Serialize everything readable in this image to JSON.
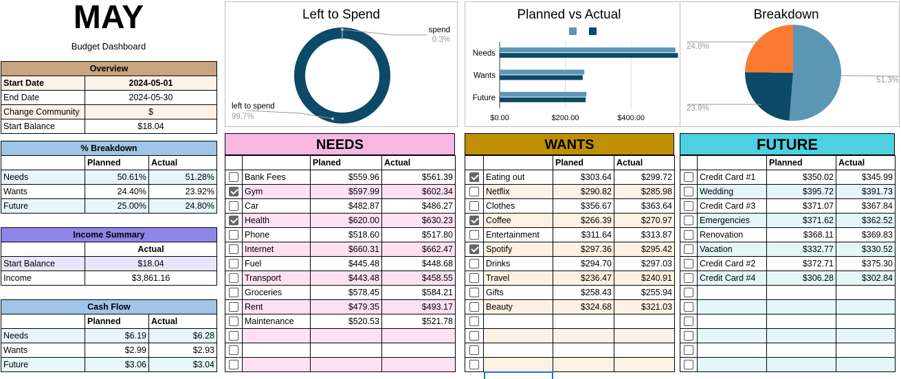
{
  "header": {
    "month": "MAY",
    "subtitle": "Budget Dashboard"
  },
  "overview": {
    "title": "Overview",
    "rows": [
      {
        "label": "Start Date",
        "value": "2024-05-01"
      },
      {
        "label": "End Date",
        "value": "2024-05-30"
      },
      {
        "label": "Change Community",
        "value": "$"
      },
      {
        "label": "Start Balance",
        "value": "$18.04"
      }
    ]
  },
  "breakdown_table": {
    "title": "% Breakdown",
    "col_planned": "Planned",
    "col_actual": "Actual",
    "rows": [
      {
        "label": "Needs",
        "planned": "50.61%",
        "actual": "51.28%"
      },
      {
        "label": "Wants",
        "planned": "24.40%",
        "actual": "23.92%"
      },
      {
        "label": "Future",
        "planned": "25.00%",
        "actual": "24.80%"
      }
    ]
  },
  "income": {
    "title": "Income Summary",
    "col_actual": "Actual",
    "rows": [
      {
        "label": "Start Balance",
        "value": "$18.04"
      },
      {
        "label": "Income",
        "value": "$3,861.16"
      }
    ]
  },
  "cashflow": {
    "title": "Cash Flow",
    "col_planned": "Planned",
    "col_actual": "Actual",
    "rows": [
      {
        "label": "Needs",
        "planned": "$6.19",
        "actual": "$6.28"
      },
      {
        "label": "Wants",
        "planned": "$2.99",
        "actual": "$2.93"
      },
      {
        "label": "Future",
        "planned": "$3.06",
        "actual": "$3.04"
      }
    ]
  },
  "needs": {
    "title": "NEEDS",
    "col_planned": "Planed",
    "col_actual": "Actual",
    "items": [
      {
        "checked": false,
        "name": "Bank Fees",
        "planned": "$559.96",
        "actual": "$561.39"
      },
      {
        "checked": true,
        "name": "Gym",
        "planned": "$597.99",
        "actual": "$602.34"
      },
      {
        "checked": false,
        "name": "Car",
        "planned": "$482.87",
        "actual": "$486.27"
      },
      {
        "checked": true,
        "name": "Health",
        "planned": "$620.00",
        "actual": "$630.23"
      },
      {
        "checked": false,
        "name": "Phone",
        "planned": "$518.60",
        "actual": "$517.80"
      },
      {
        "checked": false,
        "name": "Internet",
        "planned": "$660.31",
        "actual": "$662.47"
      },
      {
        "checked": false,
        "name": "Fuel",
        "planned": "$445.48",
        "actual": "$448.68"
      },
      {
        "checked": false,
        "name": "Transport",
        "planned": "$443.48",
        "actual": "$458.55"
      },
      {
        "checked": false,
        "name": "Groceries",
        "planned": "$578.45",
        "actual": "$584.21"
      },
      {
        "checked": false,
        "name": "Rent",
        "planned": "$479.35",
        "actual": "$493.17"
      },
      {
        "checked": false,
        "name": "Maintenance",
        "planned": "$520.53",
        "actual": "$521.78"
      },
      {
        "checked": false,
        "name": "",
        "planned": "",
        "actual": ""
      },
      {
        "checked": false,
        "name": "",
        "planned": "",
        "actual": ""
      },
      {
        "checked": false,
        "name": "",
        "planned": "",
        "actual": ""
      }
    ]
  },
  "wants": {
    "title": "WANTS",
    "col_planned": "Planed",
    "col_actual": "Actual",
    "items": [
      {
        "checked": true,
        "name": "Eating out",
        "planned": "$303.64",
        "actual": "$299.72"
      },
      {
        "checked": false,
        "name": "Netflix",
        "planned": "$290.82",
        "actual": "$285.98"
      },
      {
        "checked": false,
        "name": "Clothes",
        "planned": "$356.67",
        "actual": "$363.64"
      },
      {
        "checked": true,
        "name": "Coffee",
        "planned": "$266.39",
        "actual": "$270.97"
      },
      {
        "checked": false,
        "name": "Entertainment",
        "planned": "$311.64",
        "actual": "$313.87"
      },
      {
        "checked": true,
        "name": "Spotify",
        "planned": "$297.36",
        "actual": "$295.42"
      },
      {
        "checked": false,
        "name": "Drinks",
        "planned": "$294.70",
        "actual": "$297.03"
      },
      {
        "checked": false,
        "name": "Travel",
        "planned": "$236.47",
        "actual": "$240.91"
      },
      {
        "checked": false,
        "name": "Gifts",
        "planned": "$258.43",
        "actual": "$255.94"
      },
      {
        "checked": false,
        "name": "Beauty",
        "planned": "$324.68",
        "actual": "$321.03"
      },
      {
        "checked": false,
        "name": "",
        "planned": "",
        "actual": ""
      },
      {
        "checked": false,
        "name": "",
        "planned": "",
        "actual": ""
      },
      {
        "checked": false,
        "name": "",
        "planned": "",
        "actual": ""
      },
      {
        "checked": false,
        "name": "",
        "planned": "",
        "actual": ""
      }
    ]
  },
  "future": {
    "title": "FUTURE",
    "col_planned": "Planned",
    "col_actual": "Actual",
    "items": [
      {
        "checked": false,
        "name": "Credit Card #1",
        "planned": "$350.02",
        "actual": "$345.99"
      },
      {
        "checked": false,
        "name": "Wedding",
        "planned": "$395.72",
        "actual": "$391.73"
      },
      {
        "checked": false,
        "name": "Credit Card #3",
        "planned": "$371.07",
        "actual": "$367.84"
      },
      {
        "checked": false,
        "name": "Emergencies",
        "planned": "$371.62",
        "actual": "$362.52"
      },
      {
        "checked": false,
        "name": "Renovation",
        "planned": "$368.11",
        "actual": "$369.83"
      },
      {
        "checked": false,
        "name": "Vacation",
        "planned": "$332.77",
        "actual": "$330.52"
      },
      {
        "checked": false,
        "name": "Credit Card #2",
        "planned": "$372.71",
        "actual": "$375.30"
      },
      {
        "checked": false,
        "name": "Credit Card #4",
        "planned": "$306.28",
        "actual": "$302.84"
      },
      {
        "checked": false,
        "name": "",
        "planned": "",
        "actual": ""
      },
      {
        "checked": false,
        "name": "",
        "planned": "",
        "actual": ""
      },
      {
        "checked": false,
        "name": "",
        "planned": "",
        "actual": ""
      },
      {
        "checked": false,
        "name": "",
        "planned": "",
        "actual": ""
      },
      {
        "checked": false,
        "name": "",
        "planned": "",
        "actual": ""
      },
      {
        "checked": false,
        "name": "",
        "planned": "",
        "actual": ""
      }
    ]
  },
  "colors": {
    "overview": "#c9a57f",
    "overview_row": "#fdf3e8",
    "breakdown": "#9fc5e8",
    "breakdown_row": "#e6f7f7",
    "income": "#8e85e6",
    "income_row": "#e8e6fb",
    "needs": "#f6b8e2",
    "needs_row": "#fde1f2",
    "wants": "#bf9000",
    "wants_row": "#fdf1e4",
    "future": "#4dd0e1",
    "future_row": "#e3f7f8",
    "chart_light": "#5b96b4",
    "chart_dark": "#0b4a68",
    "chart_orange": "#fb7a2f"
  },
  "chart_data": [
    {
      "type": "pie",
      "title": "Left to Spend",
      "labels": [
        "spend",
        "left to spend"
      ],
      "values": [
        0.3,
        99.7
      ],
      "value_labels": [
        "0.3%",
        "99.7%"
      ]
    },
    {
      "type": "bar",
      "title": "Planned vs Actual",
      "categories": [
        "Needs",
        "Wants",
        "Future"
      ],
      "series": [
        {
          "values": [
            535,
            258,
            264
          ]
        },
        {
          "values": [
            543,
            253,
            262
          ]
        }
      ],
      "xlim": [
        0,
        540
      ],
      "xticks": [
        "$0.00",
        "$200.00",
        "$400.00"
      ],
      "legend": "top",
      "grid": true
    },
    {
      "type": "pie",
      "title": "Breakdown",
      "values": [
        51.3,
        23.9,
        24.8
      ],
      "value_labels": [
        "51.3%",
        "23.9%",
        "24.8%"
      ]
    }
  ]
}
